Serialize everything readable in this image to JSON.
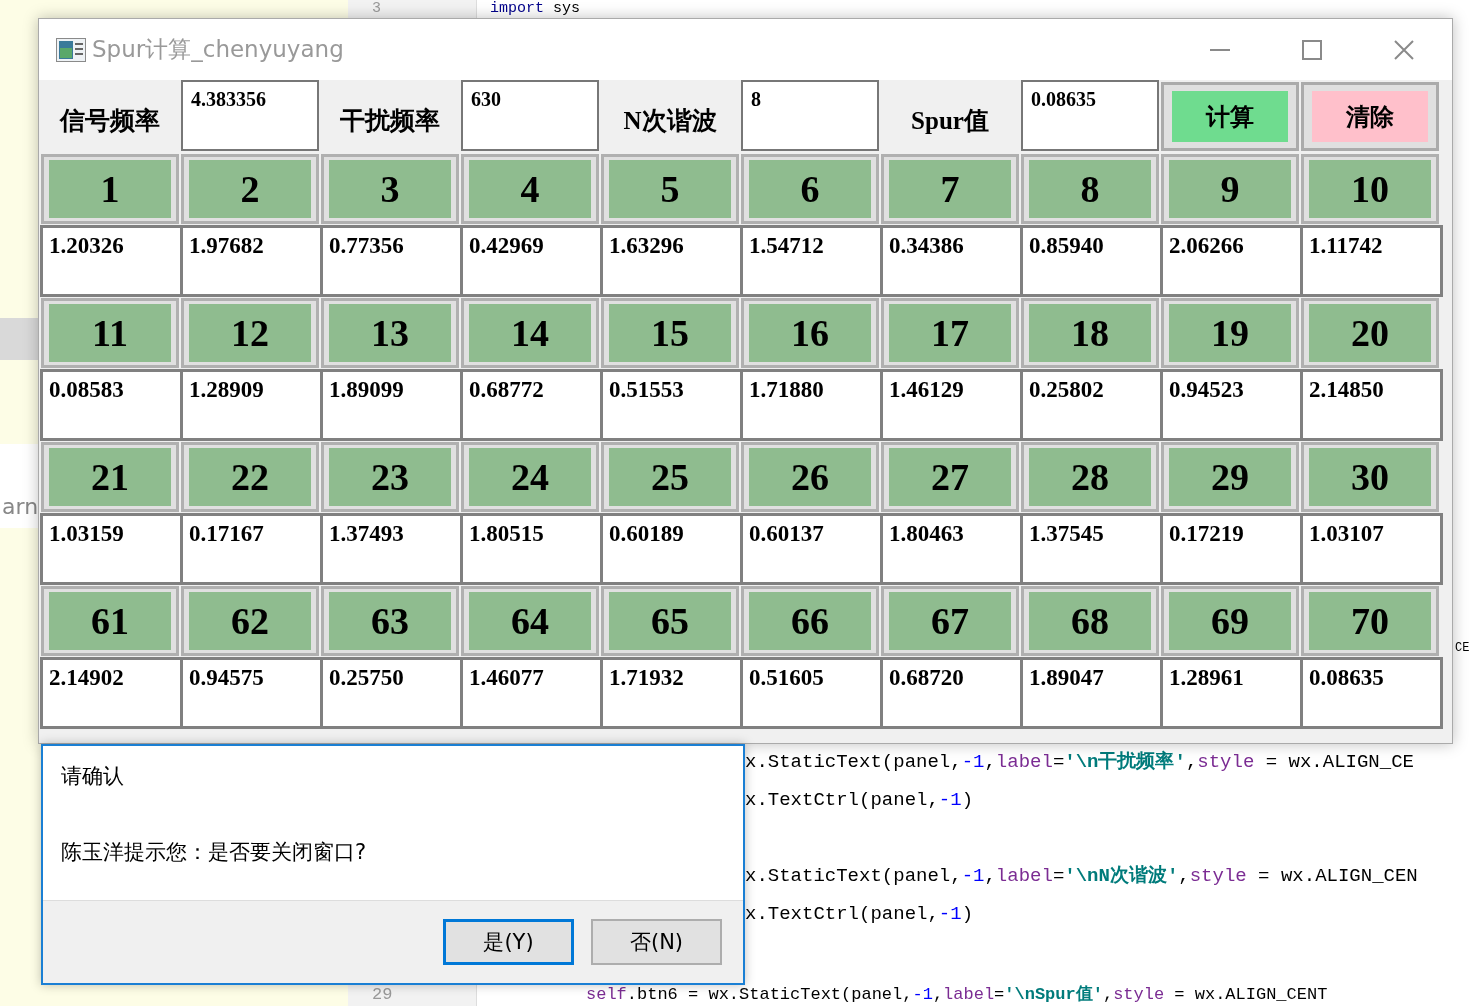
{
  "background": {
    "side_text": "arn",
    "lines": [
      {
        "number": "3",
        "tokens": [
          {
            "kind": "keyword",
            "text": "import"
          },
          {
            "kind": "plain",
            "text": " sys"
          }
        ]
      },
      {
        "tokens": [
          {
            "kind": "plain",
            "text": "CE"
          }
        ]
      },
      {
        "tokens": [
          {
            "kind": "plain",
            "text": "x.StaticText(panel,"
          },
          {
            "kind": "number",
            "text": "-1"
          },
          {
            "kind": "plain",
            "text": ","
          },
          {
            "kind": "param",
            "text": "label"
          },
          {
            "kind": "plain",
            "text": "="
          },
          {
            "kind": "string",
            "text": "'\\n干扰频率'"
          },
          {
            "kind": "plain",
            "text": ","
          },
          {
            "kind": "param",
            "text": "style"
          },
          {
            "kind": "plain",
            "text": " = wx.ALIGN_CE"
          }
        ]
      },
      {
        "tokens": [
          {
            "kind": "plain",
            "text": "x.TextCtrl(panel,"
          },
          {
            "kind": "number",
            "text": "-1"
          },
          {
            "kind": "plain",
            "text": ")"
          }
        ]
      },
      {
        "tokens": [
          {
            "kind": "plain",
            "text": "x.StaticText(panel,"
          },
          {
            "kind": "number",
            "text": "-1"
          },
          {
            "kind": "plain",
            "text": ","
          },
          {
            "kind": "param",
            "text": "label"
          },
          {
            "kind": "plain",
            "text": "="
          },
          {
            "kind": "string",
            "text": "'\\nN次谐波'"
          },
          {
            "kind": "plain",
            "text": ","
          },
          {
            "kind": "param",
            "text": "style"
          },
          {
            "kind": "plain",
            "text": " = wx.ALIGN_CEN"
          }
        ]
      },
      {
        "tokens": [
          {
            "kind": "plain",
            "text": "x.TextCtrl(panel,"
          },
          {
            "kind": "number",
            "text": "-1"
          },
          {
            "kind": "plain",
            "text": ")"
          }
        ]
      },
      {
        "number": "29",
        "tokens": [
          {
            "kind": "param",
            "text": "self"
          },
          {
            "kind": "plain",
            "text": ".btn6 = wx.StaticText(panel,"
          },
          {
            "kind": "number",
            "text": "-1"
          },
          {
            "kind": "plain",
            "text": ","
          },
          {
            "kind": "param",
            "text": "label"
          },
          {
            "kind": "plain",
            "text": "="
          },
          {
            "kind": "string",
            "text": "'\\nSpur值'"
          },
          {
            "kind": "plain",
            "text": ","
          },
          {
            "kind": "param",
            "text": "style"
          },
          {
            "kind": "plain",
            "text": " = wx.ALIGN_CENT"
          }
        ]
      }
    ]
  },
  "window": {
    "title": "Spur计算_chenyuyang"
  },
  "inputs": [
    {
      "label": "信号频率",
      "value": "4.383356"
    },
    {
      "label": "干扰频率",
      "value": "630"
    },
    {
      "label": "N次谐波",
      "value": "8"
    },
    {
      "label": "Spur值",
      "value": "0.08635"
    }
  ],
  "actions": [
    {
      "label": "计算",
      "color": "#6fdc8f"
    },
    {
      "label": "清除",
      "color": "#ffc0cb"
    }
  ],
  "grid": [
    {
      "index": "1",
      "value": "1.20326"
    },
    {
      "index": "2",
      "value": "1.97682"
    },
    {
      "index": "3",
      "value": "0.77356"
    },
    {
      "index": "4",
      "value": "0.42969"
    },
    {
      "index": "5",
      "value": "1.63296"
    },
    {
      "index": "6",
      "value": "1.54712"
    },
    {
      "index": "7",
      "value": "0.34386"
    },
    {
      "index": "8",
      "value": "0.85940"
    },
    {
      "index": "9",
      "value": "2.06266"
    },
    {
      "index": "10",
      "value": "1.11742"
    },
    {
      "index": "11",
      "value": "0.08583"
    },
    {
      "index": "12",
      "value": "1.28909"
    },
    {
      "index": "13",
      "value": "1.89099"
    },
    {
      "index": "14",
      "value": "0.68772"
    },
    {
      "index": "15",
      "value": "0.51553"
    },
    {
      "index": "16",
      "value": "1.71880"
    },
    {
      "index": "17",
      "value": "1.46129"
    },
    {
      "index": "18",
      "value": "0.25802"
    },
    {
      "index": "19",
      "value": "0.94523"
    },
    {
      "index": "20",
      "value": "2.14850"
    },
    {
      "index": "21",
      "value": "1.03159"
    },
    {
      "index": "22",
      "value": "0.17167"
    },
    {
      "index": "23",
      "value": "1.37493"
    },
    {
      "index": "24",
      "value": "1.80515"
    },
    {
      "index": "25",
      "value": "0.60189"
    },
    {
      "index": "26",
      "value": "0.60137"
    },
    {
      "index": "27",
      "value": "1.80463"
    },
    {
      "index": "28",
      "value": "1.37545"
    },
    {
      "index": "29",
      "value": "0.17219"
    },
    {
      "index": "30",
      "value": "1.03107"
    },
    {
      "index": "61",
      "value": "2.14902"
    },
    {
      "index": "62",
      "value": "0.94575"
    },
    {
      "index": "63",
      "value": "0.25750"
    },
    {
      "index": "64",
      "value": "1.46077"
    },
    {
      "index": "65",
      "value": "1.71932"
    },
    {
      "index": "66",
      "value": "0.51605"
    },
    {
      "index": "67",
      "value": "0.68720"
    },
    {
      "index": "68",
      "value": "1.89047"
    },
    {
      "index": "69",
      "value": "1.28961"
    },
    {
      "index": "70",
      "value": "0.08635"
    }
  ],
  "dialog": {
    "title": "请确认",
    "message": "陈玉洋提示您：是否要关闭窗口?",
    "buttons": [
      {
        "label": "是(Y)",
        "default": true
      },
      {
        "label": "否(N)",
        "default": false
      }
    ]
  }
}
